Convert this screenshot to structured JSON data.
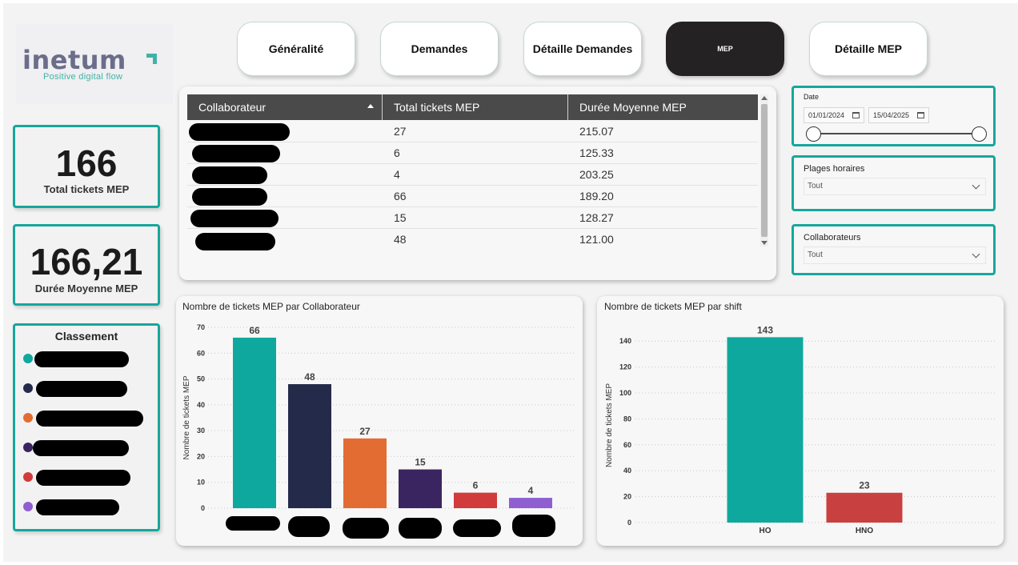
{
  "nav": {
    "items": [
      {
        "label": "Généralité",
        "active": false
      },
      {
        "label": "Demandes",
        "active": false
      },
      {
        "label": "Détaille Demandes",
        "active": false
      },
      {
        "label": "MEP",
        "active": true
      },
      {
        "label": "Détaille MEP",
        "active": false
      }
    ]
  },
  "logo": {
    "name": "inetum",
    "tagline": "Positive digital flow"
  },
  "kpis": {
    "total": {
      "value": "166",
      "label": "Total tickets MEP"
    },
    "duree": {
      "value": "166,21",
      "label": "Durée Moyenne MEP"
    }
  },
  "classement": {
    "title": "Classement",
    "items": [
      {
        "color": "#0fa89e"
      },
      {
        "color": "#242a4a"
      },
      {
        "color": "#e36c33"
      },
      {
        "color": "#3b2560"
      },
      {
        "color": "#d13b3b"
      },
      {
        "color": "#8f5fd1"
      }
    ]
  },
  "table": {
    "columns": [
      "Collaborateur",
      "Total tickets MEP",
      "Durée Moyenne MEP"
    ],
    "rows": [
      {
        "total": "27",
        "duree": "215.07"
      },
      {
        "total": "6",
        "duree": "125.33"
      },
      {
        "total": "4",
        "duree": "203.25"
      },
      {
        "total": "66",
        "duree": "189.20"
      },
      {
        "total": "15",
        "duree": "128.27"
      },
      {
        "total": "48",
        "duree": "121.00"
      }
    ]
  },
  "filters": {
    "date": {
      "title": "Date",
      "start": "01/01/2024",
      "end": "15/04/2025"
    },
    "plages": {
      "title": "Plages horaires",
      "value": "Tout"
    },
    "collaborateurs": {
      "title": "Collaborateurs",
      "value": "Tout"
    }
  },
  "colors": {
    "accent": "#16a79c",
    "nav_active": "#252223"
  },
  "charts": {
    "by_collab_title": "Nombre de tickets MEP par Collaborateur",
    "by_shift_title": "Nombre de tickets MEP par shift"
  },
  "chart_data": [
    {
      "type": "bar",
      "title": "Nombre de tickets MEP par Collaborateur",
      "ylabel": "Nombre de tickets MEP",
      "xlabel": "",
      "ylim": [
        0,
        70
      ],
      "yticks": [
        0,
        10,
        20,
        30,
        40,
        50,
        60,
        70
      ],
      "grid": true,
      "categories": [
        "",
        "",
        "",
        "",
        "",
        ""
      ],
      "values": [
        66,
        48,
        27,
        15,
        6,
        4
      ],
      "colors": [
        "#0fa89e",
        "#242a4a",
        "#e36c33",
        "#3b2560",
        "#d13b3b",
        "#8f5fd1"
      ]
    },
    {
      "type": "bar",
      "title": "Nombre de tickets MEP par shift",
      "ylabel": "Nombre de tickets MEP",
      "xlabel": "",
      "ylim": [
        0,
        150
      ],
      "yticks": [
        0,
        20,
        40,
        60,
        80,
        100,
        120,
        140
      ],
      "grid": true,
      "categories": [
        "HO",
        "HNO"
      ],
      "values": [
        143,
        23
      ],
      "colors": [
        "#0fa89e",
        "#c94040"
      ]
    }
  ]
}
